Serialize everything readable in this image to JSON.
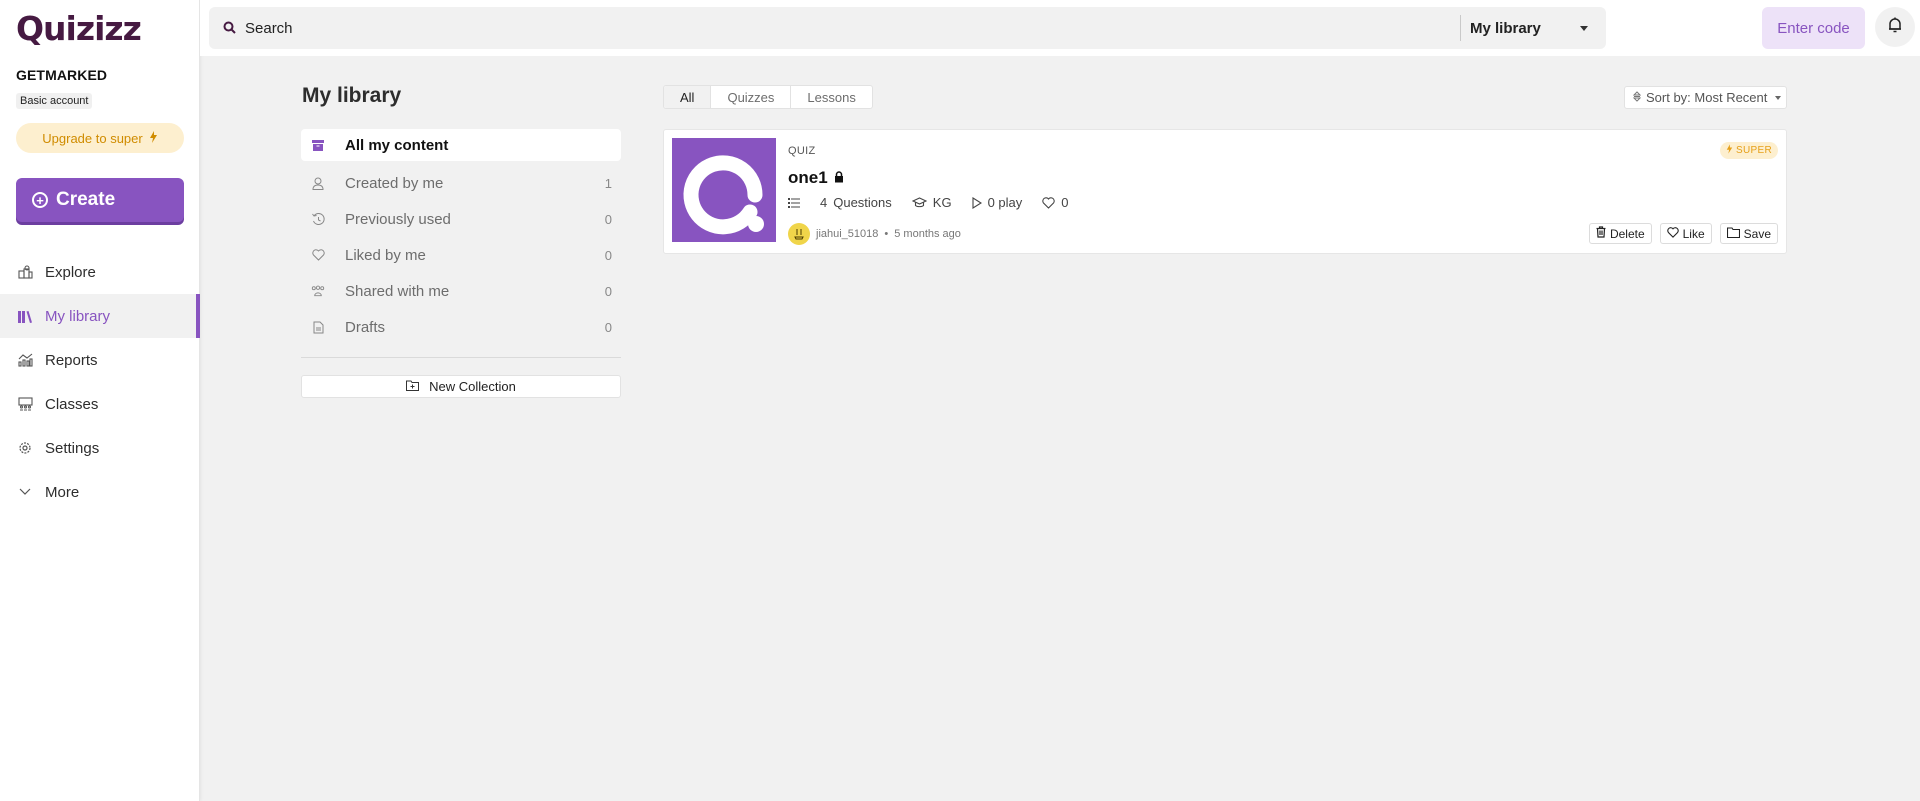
{
  "brand": {
    "logo_text": "Quizizz",
    "accent_color": "#8854c0",
    "logo_color": "#461a42"
  },
  "sidebar": {
    "org_name": "GETMARKED",
    "account_type": "Basic account",
    "upgrade_label": "Upgrade to super",
    "create_label": "Create",
    "items": [
      {
        "label": "Explore",
        "icon": "explore-icon",
        "active": false
      },
      {
        "label": "My library",
        "icon": "library-icon",
        "active": true
      },
      {
        "label": "Reports",
        "icon": "reports-icon",
        "active": false
      },
      {
        "label": "Classes",
        "icon": "classes-icon",
        "active": false
      },
      {
        "label": "Settings",
        "icon": "settings-icon",
        "active": false
      },
      {
        "label": "More",
        "icon": "chevron-down-icon",
        "active": false
      }
    ]
  },
  "topbar": {
    "search_placeholder": "Search",
    "search_value": "",
    "scope_selected": "My library",
    "enter_code_label": "Enter code"
  },
  "library": {
    "title": "My library",
    "items": [
      {
        "label": "All my content",
        "icon": "archive-box-icon",
        "count": "",
        "active": true
      },
      {
        "label": "Created by me",
        "icon": "user-icon",
        "count": "1",
        "active": false
      },
      {
        "label": "Previously used",
        "icon": "history-icon",
        "count": "0",
        "active": false
      },
      {
        "label": "Liked by me",
        "icon": "heart-icon",
        "count": "0",
        "active": false
      },
      {
        "label": "Shared with me",
        "icon": "users-icon",
        "count": "0",
        "active": false
      },
      {
        "label": "Drafts",
        "icon": "document-icon",
        "count": "0",
        "active": false
      }
    ],
    "new_collection_label": "New Collection"
  },
  "content": {
    "tabs": [
      {
        "label": "All",
        "active": true
      },
      {
        "label": "Quizzes",
        "active": false
      },
      {
        "label": "Lessons",
        "active": false
      }
    ],
    "sort_label": "Sort by: Most Recent",
    "cards": [
      {
        "type": "QUIZ",
        "title": "one1",
        "locked": true,
        "questions_count": "4",
        "questions_label": "Questions",
        "grade": "KG",
        "plays": "0 play",
        "likes": "0",
        "author": "jiahui_51018",
        "time_ago": "5 months ago",
        "badge": "SUPER",
        "actions": {
          "delete": "Delete",
          "like": "Like",
          "save": "Save"
        }
      }
    ]
  }
}
